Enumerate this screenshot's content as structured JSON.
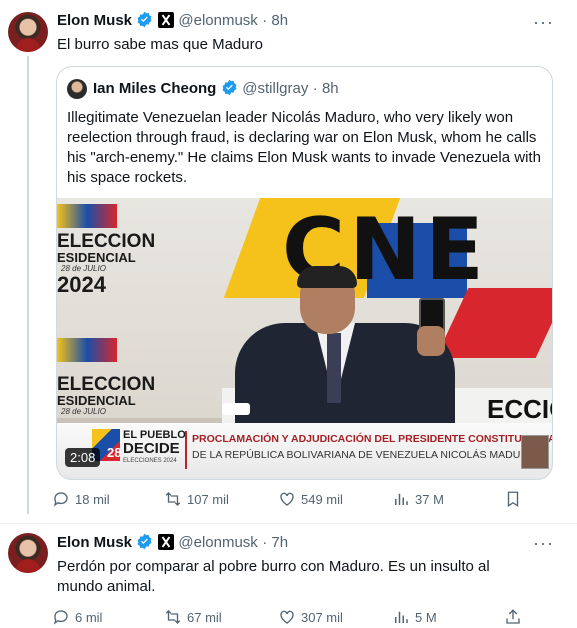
{
  "tweet1": {
    "name": "Elon Musk",
    "handle": "@elonmusk",
    "time": "· 8h",
    "text": "El burro sabe mas que Maduro",
    "quote": {
      "name": "Ian Miles Cheong",
      "handle": "@stillgray",
      "time": "· 8h",
      "text": "Illegitimate Venezuelan leader Nicolás Maduro, who very likely won reelection through fraud, is declaring war on Elon Musk, whom he calls his \"arch-enemy.\" He claims Elon Musk wants to invade Venezuela with his space rockets.",
      "video": {
        "duration": "2:08",
        "banner_line1": "PROCLAMACIÓN Y ADJUDICACIÓN DEL PRESIDENTE CONSTITUCIONAL",
        "banner_line2": "DE LA REPÚBLICA BOLIVARIANA DE VENEZUELA NICOLÁS MADURO",
        "bg_left_top": "ELECCION",
        "bg_left_top2": "ESIDENCIAL",
        "bg_date": "28 de JULIO",
        "bg_year": "2024",
        "bg_left_bottom": "ELECCION",
        "bg_left_bottom2": "ESIDENCIAL",
        "bg_date2": "28 de JULIO",
        "cne": "CNE",
        "logo_line1": "EL PUEBLO",
        "logo_line2": "DECIDE",
        "logo_line3": "ELECCIONES 2024",
        "logo_num": "28",
        "bg_bottom_right": "ECCIO"
      }
    },
    "actions": {
      "replies": "18 mil",
      "reposts": "107 mil",
      "likes": "549 mil",
      "views": "37 M"
    }
  },
  "tweet2": {
    "name": "Elon Musk",
    "handle": "@elonmusk",
    "time": "· 7h",
    "text": "Perdón por comparar al pobre burro con Maduro. Es un insulto al mundo animal.",
    "actions": {
      "replies": "6 mil",
      "reposts": "67 mil",
      "likes": "307 mil",
      "views": "5 M"
    }
  },
  "colors": {
    "verified": "#1d9bf0",
    "muted": "#536471",
    "border": "#cfd9de"
  }
}
